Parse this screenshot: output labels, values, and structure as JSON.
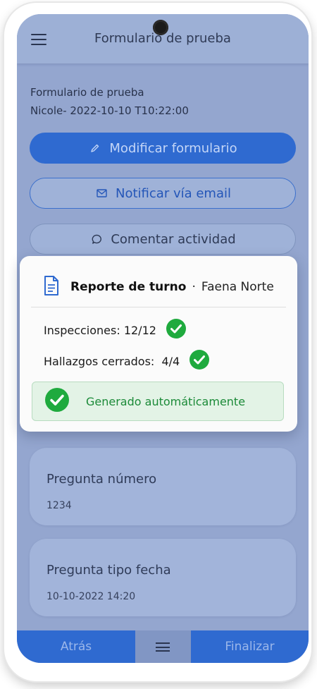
{
  "appbar": {
    "title": "Formulario de prueba",
    "menu_icon": "hamburger-menu-icon"
  },
  "form": {
    "name": "Formulario de prueba",
    "meta": "Nicole- 2022-10-10 T10:22:00"
  },
  "actions": {
    "modify_label": "Modificar formulario",
    "notify_label": "Notificar vía email",
    "comment_label": "Comentar actividad"
  },
  "questions": [
    {
      "label": "Pregunta número",
      "value": "1234"
    },
    {
      "label": "Pregunta tipo fecha",
      "value": "10-10-2022 14:20"
    }
  ],
  "bottom_nav": {
    "back_label": "Atrás",
    "finish_label": "Finalizar"
  },
  "report": {
    "title": "Reporte de turno",
    "separator": "·",
    "site": "Faena Norte",
    "inspections": "Inspecciones: 12/12",
    "findings": "Hallazgos cerrados:  4/4",
    "status": "Generado automáticamente"
  },
  "colors": {
    "primary": "#2f6ad0",
    "success": "#1faa3e",
    "screen_overlay": "#94a6cf"
  }
}
